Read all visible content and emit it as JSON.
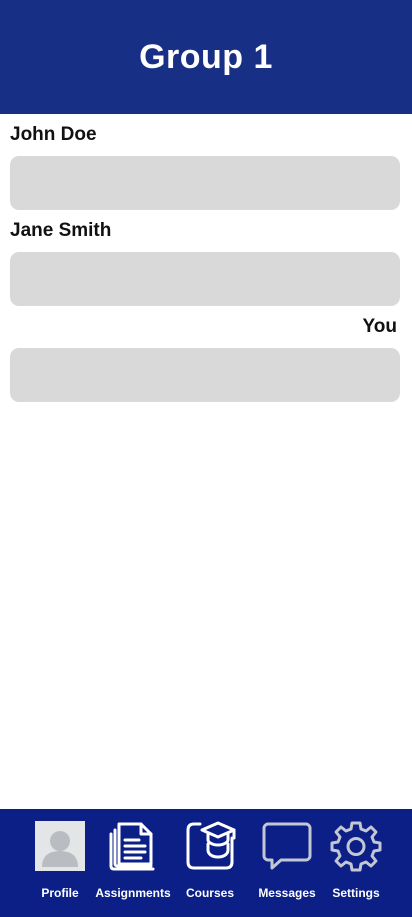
{
  "header": {
    "title": "Group 1"
  },
  "messages": [
    {
      "sender": "John Doe",
      "align": "left",
      "text": ""
    },
    {
      "sender": "Jane Smith",
      "align": "left",
      "text": ""
    },
    {
      "sender": "You",
      "align": "right",
      "text": ""
    }
  ],
  "nav": {
    "items": [
      {
        "label": "Profile",
        "icon": "avatar-icon"
      },
      {
        "label": "Assignments",
        "icon": "document-icon"
      },
      {
        "label": "Courses",
        "icon": "graduation-cap-icon"
      },
      {
        "label": "Messages",
        "icon": "chat-bubble-icon"
      },
      {
        "label": "Settings",
        "icon": "gear-icon"
      }
    ]
  },
  "colors": {
    "header_bg": "#182f86",
    "nav_bg": "#0b1f87",
    "bubble_bg": "#d9d9d9"
  }
}
